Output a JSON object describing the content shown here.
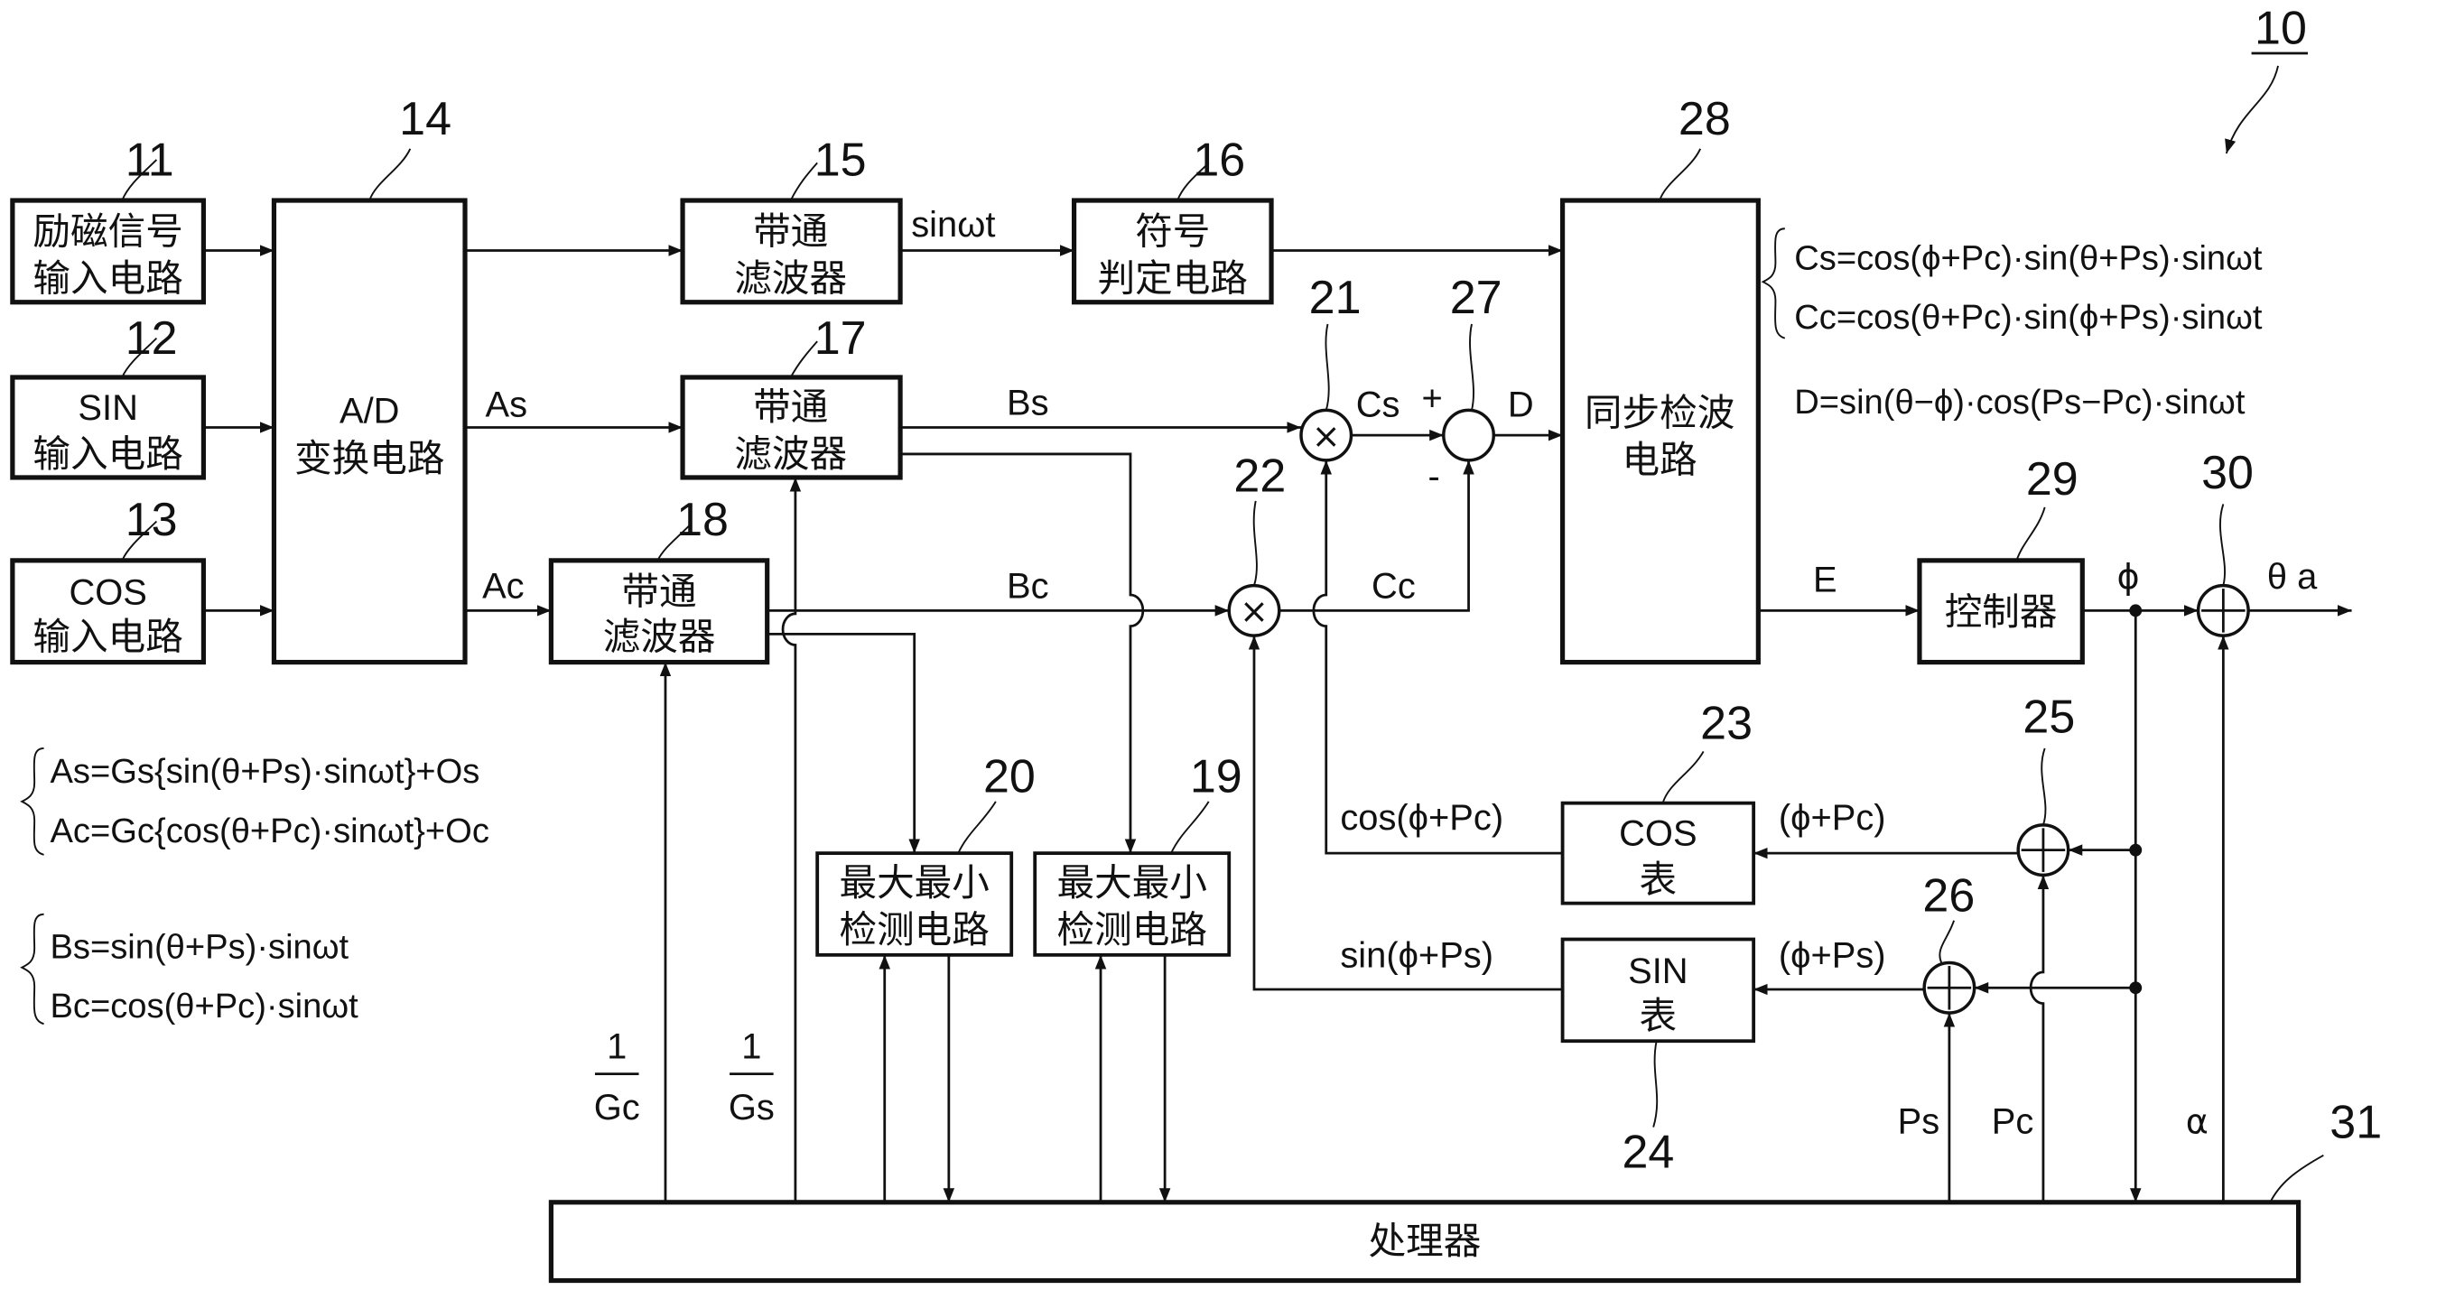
{
  "figure": {
    "ref": "10"
  },
  "blocks": {
    "excitation_input": {
      "ref": "11",
      "line1": "励磁信号",
      "line2": "输入电路"
    },
    "sin_input": {
      "ref": "12",
      "line1": "SIN",
      "line2": "输入电路"
    },
    "cos_input": {
      "ref": "13",
      "line1": "COS",
      "line2": "输入电路"
    },
    "ad_converter": {
      "ref": "14",
      "line1": "A/D",
      "line2": "变换电路"
    },
    "bandpass_ref": {
      "ref": "15",
      "line1": "带通",
      "line2": "滤波器"
    },
    "sign_judge": {
      "ref": "16",
      "line1": "符号",
      "line2": "判定电路"
    },
    "bandpass_s": {
      "ref": "17",
      "line1": "带通",
      "line2": "滤波器"
    },
    "bandpass_c": {
      "ref": "18",
      "line1": "带通",
      "line2": "滤波器"
    },
    "maxmin_s": {
      "ref": "19",
      "line1": "最大最小",
      "line2": "检测电路"
    },
    "maxmin_c": {
      "ref": "20",
      "line1": "最大最小",
      "line2": "检测电路"
    },
    "sync_detect": {
      "ref": "28",
      "line1": "同步检波",
      "line2": "电路"
    },
    "controller": {
      "ref": "29",
      "label": "控制器"
    },
    "cos_table": {
      "ref": "23",
      "line1": "COS",
      "line2": "表"
    },
    "sin_table": {
      "ref": "24",
      "line1": "SIN",
      "line2": "表"
    },
    "processor": {
      "ref": "31",
      "label": "处理器"
    }
  },
  "operators": {
    "mult_s": {
      "ref": "21",
      "symbol": "×"
    },
    "mult_c": {
      "ref": "22",
      "symbol": "×"
    },
    "subtract": {
      "ref": "27",
      "plus": "+",
      "minus": "-"
    },
    "adder_out": {
      "ref": "30",
      "symbol": "+"
    },
    "adder_pc": {
      "ref": "25",
      "symbol": "+"
    },
    "adder_ps": {
      "ref": "26",
      "symbol": "+"
    }
  },
  "signals": {
    "sinwt": "sinωt",
    "As": "As",
    "Ac": "Ac",
    "Bs": "Bs",
    "Bc": "Bc",
    "Cs": "Cs",
    "Cc": "Cc",
    "D": "D",
    "E": "E",
    "phi": "ϕ",
    "theta_a": "θ a",
    "cos_phi_pc": "cos(ϕ+Pc)",
    "sin_phi_ps": "sin(ϕ+Ps)",
    "phi_pc": "(ϕ+Pc)",
    "phi_ps": "(ϕ+Ps)",
    "Ps": "Ps",
    "Pc": "Pc",
    "alpha": "α",
    "inv_gc_num": "1",
    "inv_gc_den": "Gc",
    "inv_gs_num": "1",
    "inv_gs_den": "Gs"
  },
  "equations": {
    "A": [
      "As=Gs{sin(θ+Ps)·sinωt}+Os",
      "Ac=Gc{cos(θ+Pc)·sinωt}+Oc"
    ],
    "B": [
      "Bs=sin(θ+Ps)·sinωt",
      "Bc=cos(θ+Pc)·sinωt"
    ],
    "C": [
      "Cs=cos(ϕ+Pc)·sin(θ+Ps)·sinωt",
      "Cc=cos(θ+Pc)·sin(ϕ+Ps)·sinωt"
    ],
    "D": "D=sin(θ−ϕ)·cos(Ps−Pc)·sinωt"
  }
}
